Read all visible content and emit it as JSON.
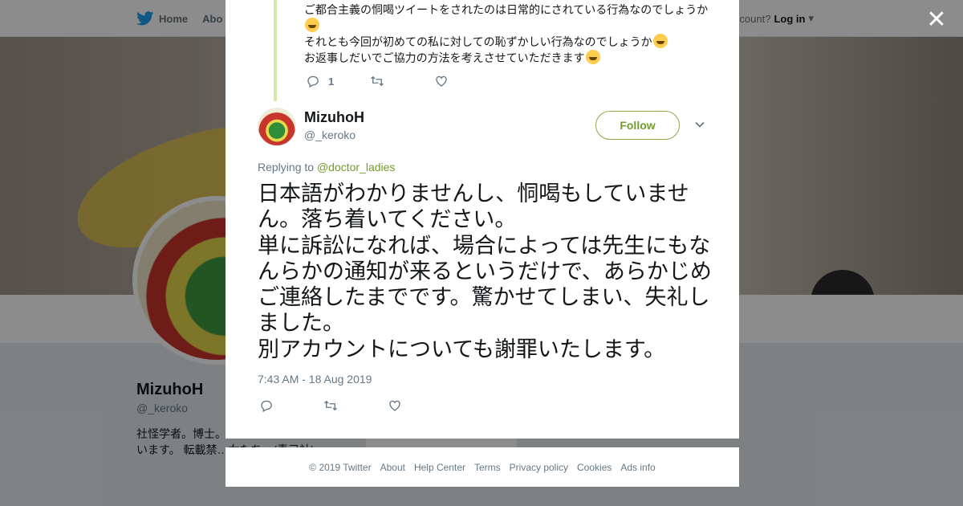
{
  "topbar": {
    "home_label": "Home",
    "about_label": "Abo",
    "account_prompt": "ccount?",
    "login_label": "Log in"
  },
  "profile": {
    "name": "MizuhoH",
    "handle": "@_keroko",
    "bio": "社怪学者。博士。…ティとジェンダー…ています。 転載禁…女たち」(青弓社)"
  },
  "parent_tweet": {
    "lines": [
      "ご都合主義の恫喝ツイートをされたのは日常的にされている行為なのでしょうか",
      "それとも今回が初めての私に対しての恥ずかしい行為なのでしょうか",
      "お返事しだいでご協力の方法を考えさせていただきます"
    ],
    "reply_count": "1"
  },
  "tweet": {
    "author_name": "MizuhoH",
    "author_handle": "@_keroko",
    "follow_label": "Follow",
    "replying_prefix": "Replying to",
    "replying_to": "@doctor_ladies",
    "text_lines": [
      "日本語がわかりませんし、恫喝もしていません。落ち着いてください。",
      "単に訴訟になれば、場合によっては先生にもなんらかの通知が来るというだけで、あらかじめご連絡したまでです。驚かせてしまい、失礼しました。",
      "別アカウントについても謝罪いたします。"
    ],
    "timestamp": "7:43 AM - 18 Aug 2019"
  },
  "footer": {
    "links": [
      "© 2019 Twitter",
      "About",
      "Help Center",
      "Terms",
      "Privacy policy",
      "Cookies",
      "Ads info"
    ]
  },
  "icons": {
    "close": "close-icon",
    "reply": "reply-icon",
    "retweet": "retweet-icon",
    "like": "heart-icon",
    "caret": "chevron-down-icon",
    "logo": "twitter-bird-icon"
  },
  "colors": {
    "accent": "#739b2c",
    "thread_line": "#d4e6a8",
    "muted_text": "#657786"
  }
}
